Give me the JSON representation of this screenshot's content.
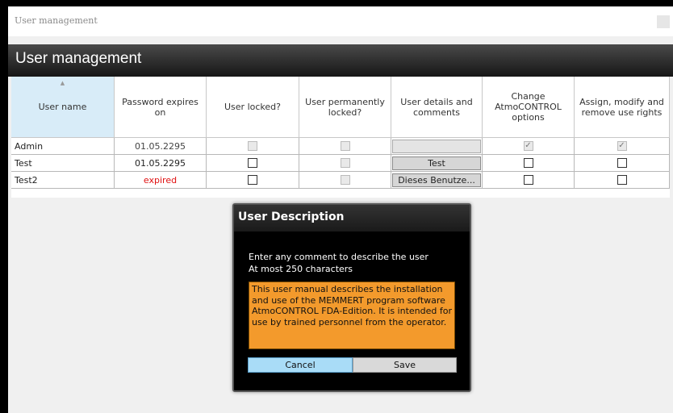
{
  "window": {
    "title": "User management"
  },
  "header": {
    "title": "User management"
  },
  "table": {
    "columns": [
      "User name",
      "Password expires on",
      "User locked?",
      "User permanently locked?",
      "User details and comments",
      "Change AtmoCONTROL options",
      "Assign, modify and remove use rights"
    ],
    "rows": [
      {
        "name": "Admin",
        "expires": "01.05.2295",
        "locked": false,
        "perm_locked": false,
        "details": "",
        "change_options": true,
        "assign_rights": true,
        "editable": false
      },
      {
        "name": "Test",
        "expires": "01.05.2295",
        "locked": false,
        "perm_locked": false,
        "details": "Test",
        "change_options": false,
        "assign_rights": false,
        "editable": true
      },
      {
        "name": "Test2",
        "expires": "expired",
        "locked": false,
        "perm_locked": false,
        "details": "Dieses Benutze...",
        "change_options": false,
        "assign_rights": false,
        "editable": true
      }
    ]
  },
  "dialog": {
    "title": "User Description",
    "line1": "Enter any comment to describe the user",
    "line2": "At most 250 characters",
    "text": "This user manual describes the installation and use of the MEMMERT program software AtmoCONTROL FDA-Edition. It is intended for use by trained personnel from the operator.",
    "cancel_label": "Cancel",
    "save_label": "Save"
  },
  "colors": {
    "expired": "#e01010",
    "dialog_text_bg": "#f39a2c",
    "cancel_bg": "#a9dcf7"
  }
}
